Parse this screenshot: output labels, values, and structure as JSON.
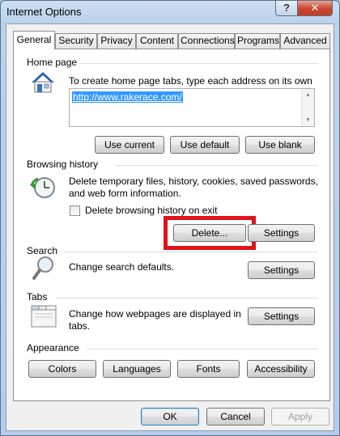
{
  "window": {
    "title": "Internet Options",
    "help_label": "?",
    "close_label": "✕"
  },
  "tabs": [
    {
      "label": "General",
      "active": true
    },
    {
      "label": "Security"
    },
    {
      "label": "Privacy"
    },
    {
      "label": "Content"
    },
    {
      "label": "Connections"
    },
    {
      "label": "Programs"
    },
    {
      "label": "Advanced"
    }
  ],
  "home_page": {
    "heading": "Home page",
    "icon": "house-icon",
    "description": "To create home page tabs, type each address on its own line.",
    "url": "http://www.rakerace.com/",
    "buttons": {
      "use_current": "Use current",
      "use_default": "Use default",
      "use_blank": "Use blank"
    }
  },
  "browsing_history": {
    "heading": "Browsing history",
    "icon": "history-clock-icon",
    "description_line1": "Delete temporary files, history, cookies, saved passwords,",
    "description_line2": "and web form information.",
    "checkbox_label": "Delete browsing history on exit",
    "checkbox_checked": false,
    "buttons": {
      "delete": "Delete...",
      "settings": "Settings"
    },
    "highlight_color": "#e0121b"
  },
  "search": {
    "heading": "Search",
    "icon": "magnifier-icon",
    "description": "Change search defaults.",
    "buttons": {
      "settings": "Settings"
    }
  },
  "tabs_section": {
    "heading": "Tabs",
    "icon": "tabs-window-icon",
    "description_line1": "Change how webpages are displayed in",
    "description_line2": "tabs.",
    "buttons": {
      "settings": "Settings"
    }
  },
  "appearance": {
    "heading": "Appearance",
    "buttons": {
      "colors": "Colors",
      "languages": "Languages",
      "fonts": "Fonts",
      "accessibility": "Accessibility"
    }
  },
  "footer": {
    "ok": "OK",
    "cancel": "Cancel",
    "apply": "Apply",
    "apply_enabled": false
  }
}
